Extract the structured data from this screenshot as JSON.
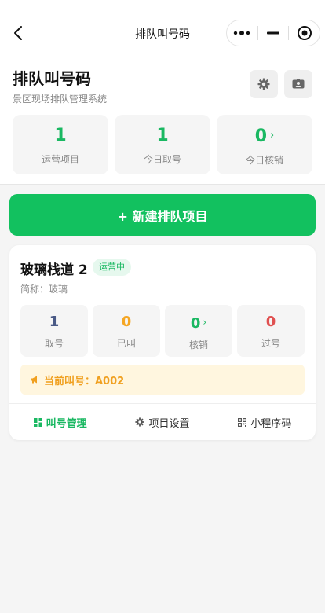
{
  "navbar": {
    "title": "排队叫号码"
  },
  "header": {
    "title": "排队叫号码",
    "subtitle": "景区现场排队管理系统",
    "stats": [
      {
        "value": "1",
        "label": "运营项目"
      },
      {
        "value": "1",
        "label": "今日取号"
      },
      {
        "value": "0",
        "label": "今日核销",
        "arrow": "›"
      }
    ]
  },
  "new_button": {
    "label": "+ 新建排队项目"
  },
  "project": {
    "name": "玻璃栈道 2",
    "status": "运营中",
    "abbr": "简称：玻璃",
    "stats": [
      {
        "value": "1",
        "label": "取号",
        "color": "#4a5a86"
      },
      {
        "value": "0",
        "label": "已叫",
        "color": "#f5a623"
      },
      {
        "value": "0",
        "label": "核销",
        "color": "#1ab862",
        "arrow": "›"
      },
      {
        "value": "0",
        "label": "过号",
        "color": "#e05050"
      }
    ],
    "current_call": "当前叫号：A002",
    "actions": [
      {
        "label": "叫号管理",
        "icon": "grid-icon"
      },
      {
        "label": "项目设置",
        "icon": "gear-icon"
      },
      {
        "label": "小程序码",
        "icon": "qrcode-icon"
      }
    ]
  },
  "colors": {
    "primary": "#12c15f",
    "accent_green": "#1ab862",
    "warning": "#f0a020"
  }
}
